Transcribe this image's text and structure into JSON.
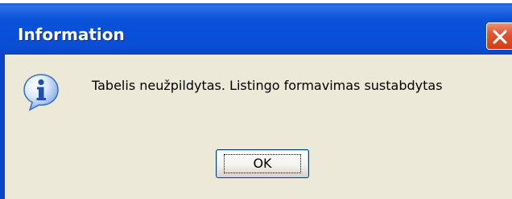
{
  "dialog": {
    "title": "Information",
    "message": "Tabelis neužpildytas. Listingo formavimas sustabdytas",
    "icon": "information-icon",
    "buttons": {
      "ok_label": "OK"
    },
    "close_icon": "close-icon"
  },
  "colors": {
    "titlebar": "#0a52d9",
    "body": "#ece9d8",
    "close_button": "#e0562f"
  }
}
